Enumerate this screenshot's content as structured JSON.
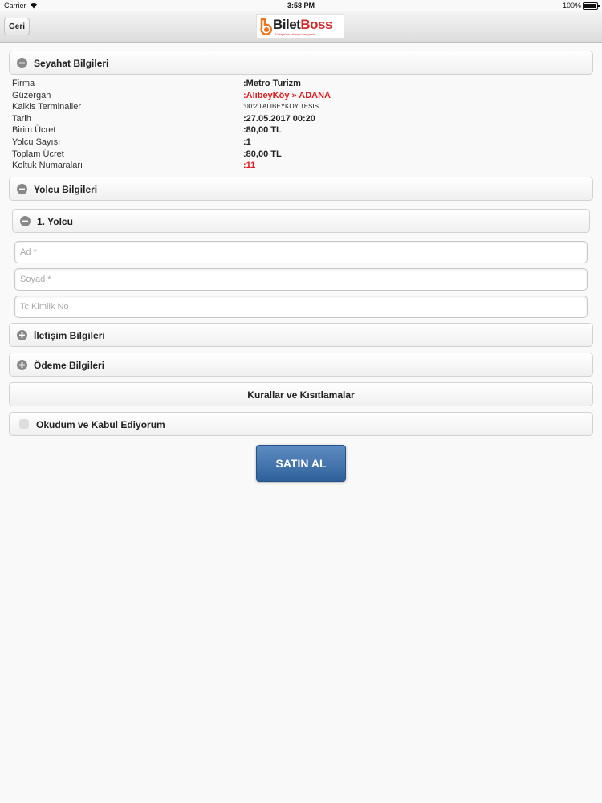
{
  "status_bar": {
    "carrier": "Carrier",
    "time": "3:58 PM",
    "battery": "100%"
  },
  "header": {
    "back_label": "Geri",
    "logo_text_a": "Bilet",
    "logo_text_b": "Boss",
    "logo_tagline": "Türkiye'nin biletçisi her yerde",
    "brand_color": "#d6292b"
  },
  "trip": {
    "section_title": "Seyahat Bilgileri",
    "rows": [
      {
        "label": "Firma",
        "value": ":Metro Turizm"
      },
      {
        "label": "Güzergah",
        "value": ":AlibeyKöy » ADANA"
      },
      {
        "label": "Kalkis Terminaller",
        "value": ":00:20 ALIBEYKOY TESIS"
      },
      {
        "label": "Tarih",
        "value": ":27.05.2017 00:20"
      },
      {
        "label": "Birim Ücret",
        "value": ":80,00 TL"
      },
      {
        "label": "Yolcu Sayısı",
        "value": ":1"
      },
      {
        "label": "Toplam Ücret",
        "value": ":80,00 TL"
      },
      {
        "label": "Koltuk Numaraları",
        "value": ":11"
      }
    ]
  },
  "passenger": {
    "section_title": "Yolcu Bilgileri",
    "sub_title": "1. Yolcu",
    "fields": {
      "first_name_placeholder": "Ad *",
      "last_name_placeholder": "Soyad *",
      "tc_placeholder": "Tc Kimlik No"
    }
  },
  "contact": {
    "section_title": "İletişim Bilgileri"
  },
  "payment": {
    "section_title": "Ödeme Bilgileri"
  },
  "rules": {
    "label": "Kurallar ve Kısıtlamalar"
  },
  "agreement": {
    "label": "Okudum ve Kabul Ediyorum",
    "checked": false
  },
  "buy_button": {
    "label": "SATIN AL",
    "color": "#3a6ba6"
  }
}
